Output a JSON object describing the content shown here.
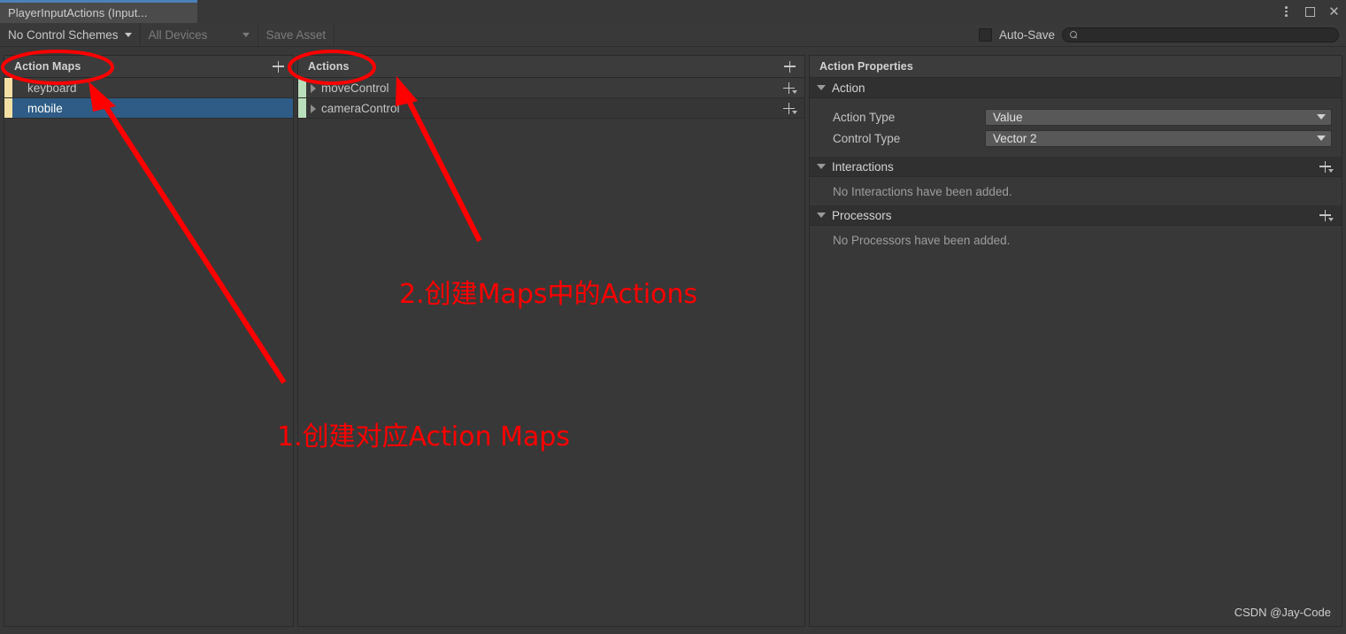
{
  "window": {
    "tab_title": "PlayerInputActions (Input...",
    "controls": [
      {
        "name": "more-options",
        "icon": "kebab-menu-icon"
      },
      {
        "name": "maximize",
        "icon": "maximize-icon"
      },
      {
        "name": "close",
        "icon": "close-icon"
      }
    ],
    "accent_color": "#4b80b8"
  },
  "toolbar": {
    "control_schemes": "No Control Schemes",
    "devices": "All Devices",
    "save_asset": "Save Asset",
    "auto_save_label": "Auto-Save",
    "auto_save_checked": false,
    "search_value": "",
    "search_placeholder": ""
  },
  "action_maps_panel": {
    "title": "Action Maps",
    "add_label": "+",
    "items": [
      {
        "name": "keyboard",
        "selected": false,
        "strip_color": "#f2e0a4"
      },
      {
        "name": "mobile",
        "selected": true,
        "strip_color": "#f2e0a4"
      }
    ]
  },
  "actions_panel": {
    "title": "Actions",
    "add_label": "+",
    "items": [
      {
        "name": "moveControl",
        "expanded": false,
        "strip_color": "#b9debb"
      },
      {
        "name": "cameraControl",
        "expanded": false,
        "strip_color": "#b9debb"
      }
    ]
  },
  "properties_panel": {
    "title": "Action Properties",
    "sections": [
      {
        "id": "action",
        "title": "Action",
        "expanded": true,
        "has_add": false,
        "fields": [
          {
            "label": "Action Type",
            "value": "Value"
          },
          {
            "label": "Control Type",
            "value": "Vector 2"
          }
        ]
      },
      {
        "id": "interactions",
        "title": "Interactions",
        "expanded": true,
        "has_add": true,
        "empty_text": "No Interactions have been added."
      },
      {
        "id": "processors",
        "title": "Processors",
        "expanded": true,
        "has_add": true,
        "empty_text": "No Processors have been added."
      }
    ]
  },
  "watermark": "CSDN @Jay-Code",
  "annotations": {
    "color": "#ff0000",
    "texts": [
      {
        "id": "step1",
        "text": "1.创建对应Action Maps"
      },
      {
        "id": "step2",
        "text": "2.创建Maps中的Actions"
      }
    ]
  }
}
